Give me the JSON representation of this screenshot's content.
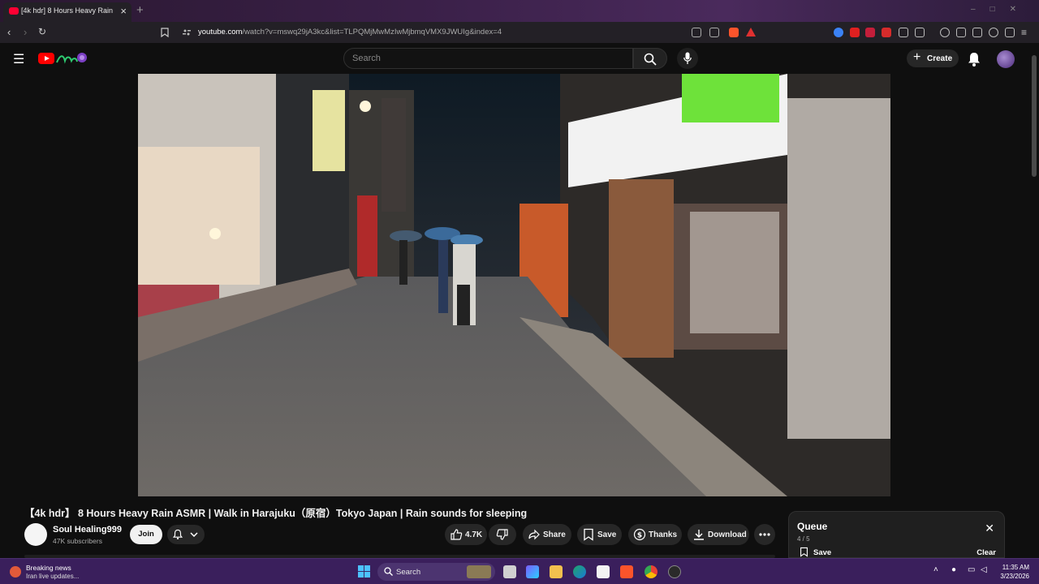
{
  "browser": {
    "tab_title": "[4k hdr] 8 Hours Heavy Rain",
    "new_tab": "+",
    "url_domain": "youtube.com",
    "url_path": "/watch?v=mswq29jA3kc&list=TLPQMjMwMzIwMjbmqVMX9JWUIg&index=4"
  },
  "youtube": {
    "search_placeholder": "Search",
    "create_label": "Create"
  },
  "video": {
    "title": "【4k hdr】 8 Hours Heavy Rain ASMR | Walk in Harajuku（原宿）Tokyo Japan | Rain sounds for sleeping",
    "channel_name": "Soul Healing999",
    "subscribers": "47K subscribers",
    "join_label": "Join",
    "likes": "4.7K",
    "share_label": "Share",
    "save_label": "Save",
    "thanks_label": "Thanks",
    "download_label": "Download"
  },
  "queue": {
    "title": "Queue",
    "count": "4 / 5",
    "save_label": "Save",
    "clear_label": "Clear"
  },
  "taskbar": {
    "news_title": "Breaking news",
    "news_sub": "Iran live updates...",
    "search_label": "Search",
    "time": "11:35 AM",
    "date": "3/23/2026"
  },
  "colors": {
    "yt_red": "#ff0000",
    "background": "#0f0f0f",
    "taskbar": "#3a1f5c"
  }
}
